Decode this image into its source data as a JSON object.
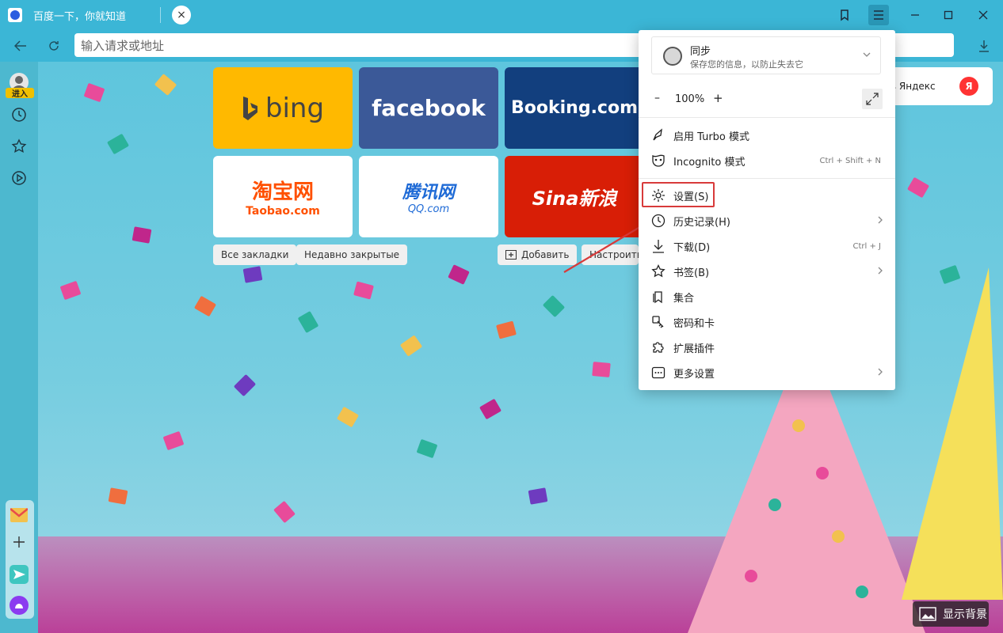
{
  "window": {
    "tab_title": "百度一下，你就知道",
    "tab_close_glyph": "×",
    "address_placeholder": "输入请求或地址"
  },
  "sidebar": {
    "login_badge": "进入"
  },
  "tiles": {
    "bing": "bing",
    "facebook": "facebook",
    "booking": "Booking.com",
    "taobao_cn": "淘宝网",
    "taobao_en": "Taobao.com",
    "qq_cn": "腾讯网",
    "qq_en": "QQ.com",
    "sina": "Sina新浪",
    "yandex": "в Яндекс",
    "yandex_logo": "Я"
  },
  "chips": {
    "all_bookmarks": "Все закладки",
    "recently_closed": "Недавно закрытые",
    "add": "Добавить",
    "customize": "Настроить"
  },
  "menu": {
    "sync_title": "同步",
    "sync_sub": "保存您的信息，以防止失去它",
    "zoom_minus": "–",
    "zoom_value": "100%",
    "zoom_plus": "+",
    "items": [
      {
        "label": "启用 Turbo 模式",
        "shortcut": ""
      },
      {
        "label": "Incognito 模式",
        "shortcut": "Ctrl + Shift + N"
      },
      {
        "label": "设置(S)",
        "shortcut": ""
      },
      {
        "label": "历史记录(H)",
        "shortcut": ""
      },
      {
        "label": "下载(D)",
        "shortcut": "Ctrl + J"
      },
      {
        "label": "书签(B)",
        "shortcut": ""
      },
      {
        "label": "集合",
        "shortcut": ""
      },
      {
        "label": "密码和卡",
        "shortcut": ""
      },
      {
        "label": "扩展插件",
        "shortcut": ""
      },
      {
        "label": "更多设置",
        "shortcut": ""
      }
    ]
  },
  "footer": {
    "show_background": "显示背景"
  },
  "colors": {
    "titlebar": "#3bb6d6",
    "highlight": "#d83a3a"
  }
}
